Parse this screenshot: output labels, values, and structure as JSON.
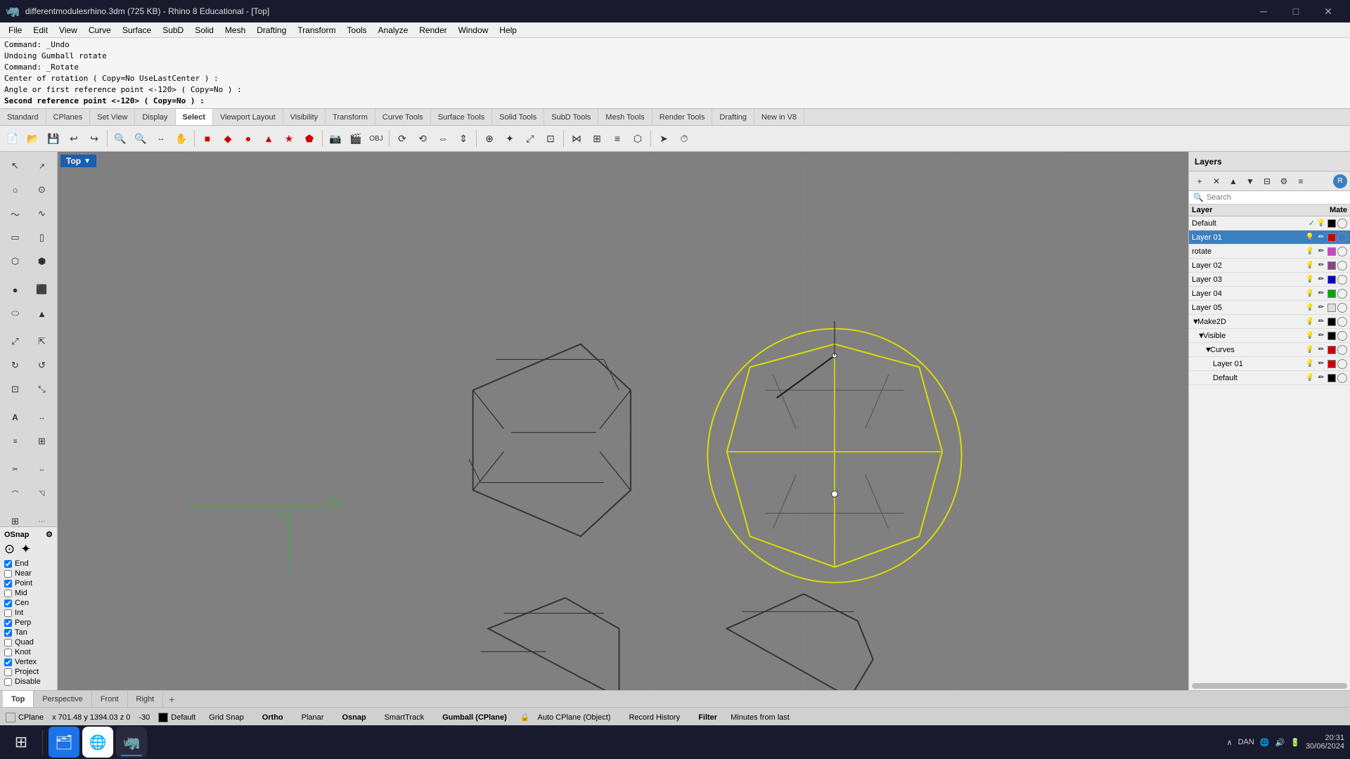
{
  "titlebar": {
    "icon": "🦏",
    "title": "differentmodulesrhino.3dm (725 KB) - Rhino 8 Educational - [Top]",
    "controls": [
      "─",
      "□",
      "✕"
    ]
  },
  "menubar": {
    "items": [
      "File",
      "Edit",
      "View",
      "Curve",
      "Surface",
      "SubD",
      "Solid",
      "Mesh",
      "Drafting",
      "Transform",
      "Tools",
      "Analyze",
      "Render",
      "Window",
      "Help"
    ]
  },
  "command_area": {
    "lines": [
      "Command: _Undo",
      "Undoing Gumball rotate",
      "Command: _Rotate",
      "Center of rotation ( Copy=No  UseLastCenter ) :",
      "Angle or first reference point <-120> ( Copy=No ) :"
    ],
    "bold_line": "Second reference point <-120> ( Copy=No ) :"
  },
  "toolbar_tabs": {
    "items": [
      "Standard",
      "CPlanes",
      "Set View",
      "Display",
      "Select",
      "Viewport Layout",
      "Visibility",
      "Transform",
      "Curve Tools",
      "Surface Tools",
      "Solid Tools",
      "SubD Tools",
      "Mesh Tools",
      "Render Tools",
      "Drafting",
      "New in V8"
    ]
  },
  "viewport": {
    "label": "Top",
    "arrow": "▼"
  },
  "osnap": {
    "title": "OSnap",
    "items": [
      {
        "label": "End",
        "checked": true
      },
      {
        "label": "Near",
        "checked": false
      },
      {
        "label": "Point",
        "checked": true
      },
      {
        "label": "Mid",
        "checked": false
      },
      {
        "label": "Cen",
        "checked": true
      },
      {
        "label": "Int",
        "checked": false
      },
      {
        "label": "Perp",
        "checked": true
      },
      {
        "label": "Tan",
        "checked": true
      },
      {
        "label": "Quad",
        "checked": false
      },
      {
        "label": "Knot",
        "checked": false
      },
      {
        "label": "Vertex",
        "checked": true
      },
      {
        "label": "Project",
        "checked": false
      },
      {
        "label": "Disable",
        "checked": false
      }
    ]
  },
  "layers": {
    "title": "Layers",
    "search_placeholder": "Search",
    "col_layer": "Layer",
    "col_mate": "Mate",
    "rows": [
      {
        "name": "Default",
        "indent": 0,
        "active": false,
        "checked": true,
        "color": "#000000"
      },
      {
        "name": "Layer 01",
        "indent": 0,
        "active": true,
        "checked": true,
        "color": "#cc0000"
      },
      {
        "name": "rotate",
        "indent": 0,
        "active": false,
        "checked": true,
        "color": "#cc44cc"
      },
      {
        "name": "Layer 02",
        "indent": 0,
        "active": false,
        "checked": true,
        "color": "#884488"
      },
      {
        "name": "Layer 03",
        "indent": 0,
        "active": false,
        "checked": true,
        "color": "#0000cc"
      },
      {
        "name": "Layer 04",
        "indent": 0,
        "active": false,
        "checked": true,
        "color": "#00aa00"
      },
      {
        "name": "Layer 05",
        "indent": 0,
        "active": false,
        "checked": true,
        "color": "#dddddd"
      },
      {
        "name": "Make2D",
        "indent": 0,
        "active": false,
        "checked": true,
        "color": "#000000",
        "has_child": true
      },
      {
        "name": "Visible",
        "indent": 1,
        "active": false,
        "checked": true,
        "color": "#000000",
        "has_child": true
      },
      {
        "name": "Curves",
        "indent": 2,
        "active": false,
        "checked": true,
        "color": "#cc0000",
        "has_child": true
      },
      {
        "name": "Layer 01",
        "indent": 3,
        "active": false,
        "checked": true,
        "color": "#cc0000"
      },
      {
        "name": "Default",
        "indent": 3,
        "active": false,
        "checked": true,
        "color": "#000000"
      }
    ]
  },
  "viewport_tabs": {
    "items": [
      "Top",
      "Perspective",
      "Front",
      "Right"
    ],
    "active": "Top",
    "add_icon": "+"
  },
  "statusbar": {
    "cplane": "CPlane",
    "coords": "x 701.48  y 1394.03  z 0",
    "zoom": "-30",
    "layer": "Default",
    "items": [
      "Grid Snap",
      "Ortho",
      "Planar",
      "Osnap",
      "SmartTrack",
      "Gumball (CPlane)",
      "Auto CPlane (Object)",
      "Record History",
      "Filter",
      "Minutes from last"
    ]
  },
  "taskbar": {
    "start_icon": "⊞",
    "apps": [
      {
        "icon": "🗂",
        "label": "file-explorer"
      },
      {
        "icon": "🟡",
        "label": "chrome"
      },
      {
        "icon": "🦏",
        "label": "rhino"
      }
    ],
    "time": "20:31",
    "date": "30/06/2024",
    "lang": "DAN"
  }
}
